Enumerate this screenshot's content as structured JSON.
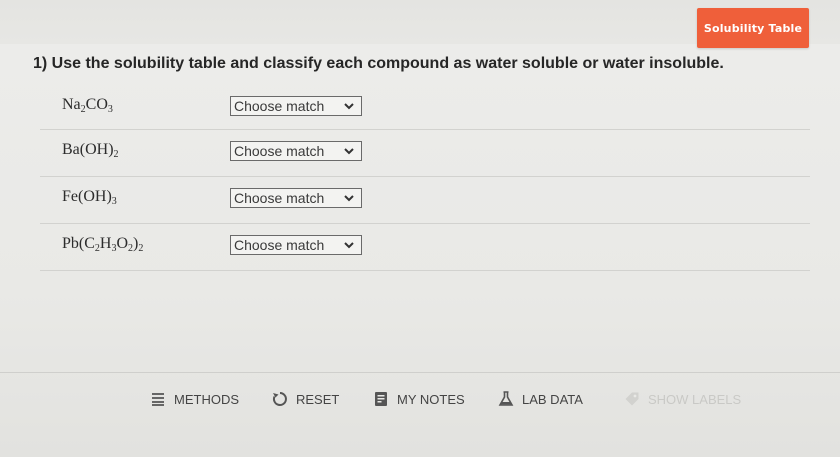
{
  "header": {
    "solubility_button": "Solubility Table"
  },
  "question": {
    "text": "1) Use the solubility table and classify each compound as water soluble or water insoluble."
  },
  "rows": [
    {
      "compound_parts": [
        [
          "t",
          "Na"
        ],
        [
          "s",
          "2"
        ],
        [
          "t",
          "CO"
        ],
        [
          "s",
          "3"
        ]
      ],
      "select_value": "Choose match"
    },
    {
      "compound_parts": [
        [
          "t",
          "Ba(OH)"
        ],
        [
          "s",
          "2"
        ]
      ],
      "select_value": "Choose match"
    },
    {
      "compound_parts": [
        [
          "t",
          "Fe(OH)"
        ],
        [
          "s",
          "3"
        ]
      ],
      "select_value": "Choose match"
    },
    {
      "compound_parts": [
        [
          "t",
          "Pb(C"
        ],
        [
          "s",
          "2"
        ],
        [
          "t",
          "H"
        ],
        [
          "s",
          "3"
        ],
        [
          "t",
          "O"
        ],
        [
          "s",
          "2"
        ],
        [
          "t",
          ")"
        ],
        [
          "s",
          "2"
        ]
      ],
      "select_value": "Choose match"
    }
  ],
  "toolbar": {
    "methods": "METHODS",
    "reset": "RESET",
    "my_notes": "MY NOTES",
    "lab_data": "LAB DATA",
    "show_labels": "SHOW LABELS"
  },
  "colors": {
    "accent": "#ef5f3a",
    "disabled": "#c9c9c6"
  }
}
